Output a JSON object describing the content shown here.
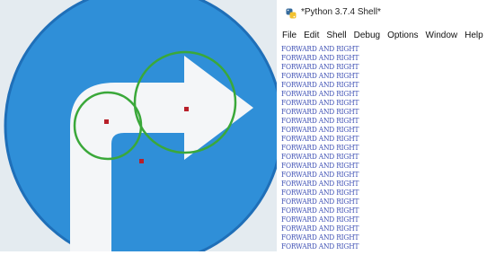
{
  "shell": {
    "title": "*Python 3.7.4 Shell*",
    "menu": [
      "File",
      "Edit",
      "Shell",
      "Debug",
      "Options",
      "Window",
      "Help"
    ],
    "output_lines": [
      "FORWARD AND RIGHT",
      "FORWARD AND RIGHT",
      "FORWARD AND RIGHT",
      "FORWARD AND RIGHT",
      "FORWARD AND RIGHT",
      "FORWARD AND RIGHT",
      "FORWARD AND RIGHT",
      "FORWARD AND RIGHT",
      "FORWARD AND RIGHT",
      "FORWARD AND RIGHT",
      "FORWARD AND RIGHT",
      "FORWARD AND RIGHT",
      "FORWARD AND RIGHT",
      "FORWARD AND RIGHT",
      "FORWARD AND RIGHT",
      "FORWARD AND RIGHT",
      "FORWARD AND RIGHT",
      "FORWARD AND RIGHT",
      "FORWARD AND RIGHT",
      "FORWARD AND RIGHT",
      "FORWARD AND RIGHT",
      "FORWARD AND RIGHT",
      "FORWARD AND RIGHT"
    ]
  },
  "camera": {
    "sign_color": "#2f8fd8",
    "detection_circle_color": "#3aa83a",
    "marker_color": "#b8202a"
  },
  "icons": {
    "window_icon": "python-icon"
  }
}
